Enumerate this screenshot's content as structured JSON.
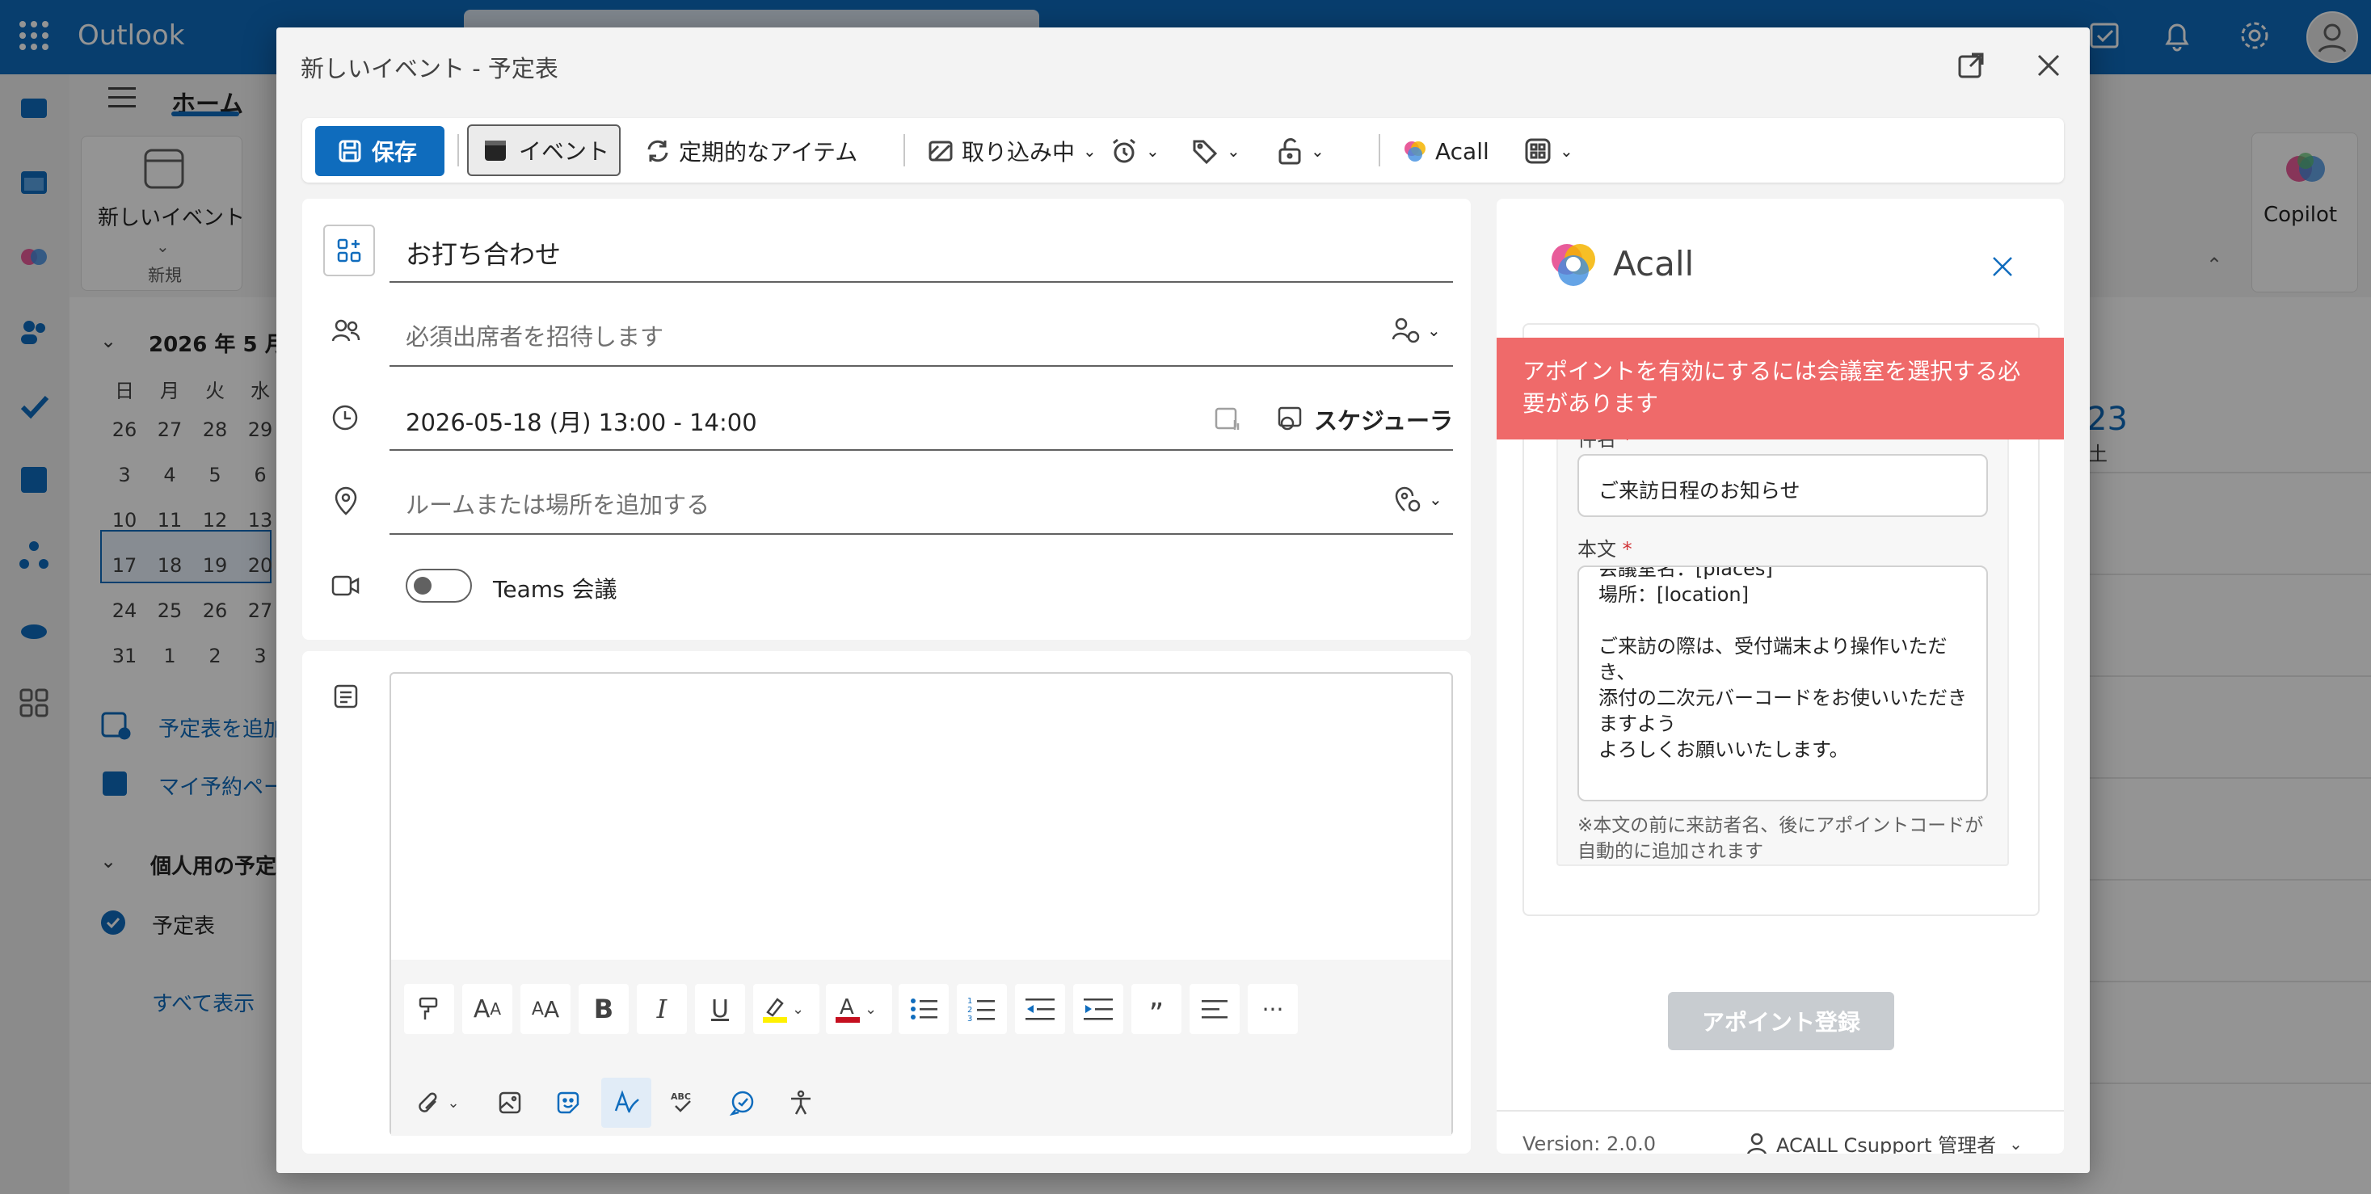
{
  "outlook": {
    "brand": "Outlook",
    "ribbon_tab_home": "ホーム",
    "new_event": "新しいイベント",
    "new_group": "新規",
    "copilot": "Copilot",
    "month_title": "2026 年 5 月",
    "weekdays": [
      "日",
      "月",
      "火",
      "水"
    ],
    "mini_weeks": [
      [
        "26",
        "27",
        "28",
        "29"
      ],
      [
        "3",
        "4",
        "5",
        "6"
      ],
      [
        "10",
        "11",
        "12",
        "13"
      ],
      [
        "17",
        "18",
        "19",
        "20"
      ],
      [
        "24",
        "25",
        "26",
        "27"
      ],
      [
        "31",
        "1",
        "2",
        "3"
      ]
    ],
    "add_calendar": "予定表を追加",
    "my_reservation": "マイ予約ペー",
    "personal_calendars": "個人用の予定",
    "calendar_name": "予定表",
    "show_all": "すべて表示",
    "day_number": "23",
    "day_label": "土"
  },
  "dialog": {
    "title": "新しいイベント - 予定表",
    "toolbar": {
      "save": "保存",
      "event": "イベント",
      "recurring": "定期的なアイテム",
      "busy": "取り込み中",
      "acall": "Acall"
    },
    "form": {
      "title_value": "お打ち合わせ",
      "attendees_placeholder": "必須出席者を招待します",
      "datetime": "2026-05-18 (月) 13:00 - 14:00",
      "scheduler": "スケジューラ",
      "location_placeholder": "ルームまたは場所を追加する",
      "teams_label": "Teams 会議",
      "teams_enabled": false
    }
  },
  "acall": {
    "brand": "Acall",
    "alert": "アポイントを有効にするには会議室を選択する必要があります",
    "subject_label": "件名",
    "required_mark": "*",
    "subject_value": "ご来訪日程のお知らせ",
    "body_label": "本文",
    "body_value": "会議室名：[places]\n場所：[location]\n\nご来訪の際は、受付端末より操作いただき、\n添付の二次元バーコードをお使いいただきますよう\nよろしくお願いいたします。",
    "note": "※本文の前に来訪者名、後にアポイントコードが自動的に追加されます",
    "register_button": "アポイント登録",
    "version": "Version: 2.0.0",
    "user": "ACALL Csupport 管理者"
  },
  "colors": {
    "accent": "#0f6cbd",
    "alert": "#ef6a6a",
    "disabled_button": "#c8ccd0"
  }
}
